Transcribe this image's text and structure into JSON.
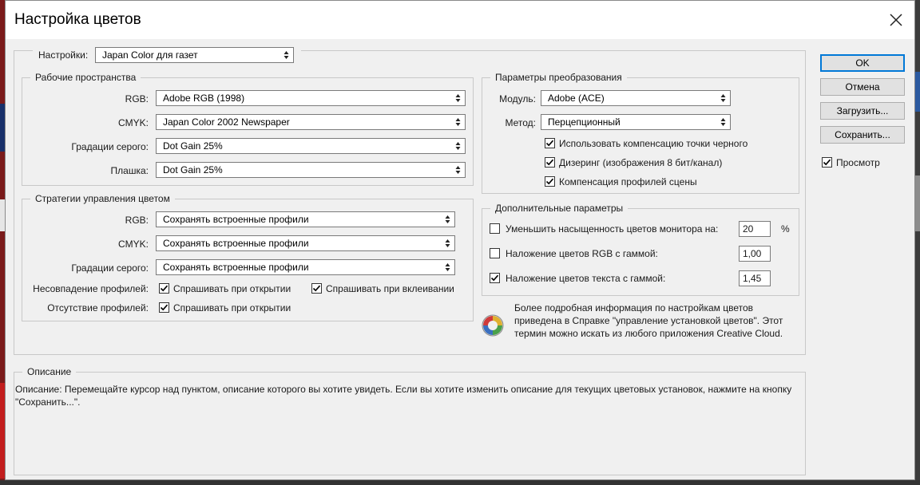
{
  "window": {
    "title": "Настройка цветов",
    "close_glyph": "close-icon"
  },
  "settings": {
    "label": "Настройки:",
    "value": "Japan Color для газет"
  },
  "working_spaces": {
    "legend": "Рабочие пространства",
    "rows": [
      {
        "label": "RGB:",
        "value": "Adobe RGB (1998)"
      },
      {
        "label": "CMYK:",
        "value": "Japan Color 2002 Newspaper"
      },
      {
        "label": "Градации серого:",
        "value": "Dot Gain 25%"
      },
      {
        "label": "Плашка:",
        "value": "Dot Gain 25%"
      }
    ]
  },
  "color_policies": {
    "legend": "Стратегии управления цветом",
    "rows": [
      {
        "label": "RGB:",
        "value": "Сохранять встроенные профили"
      },
      {
        "label": "CMYK:",
        "value": "Сохранять встроенные профили"
      },
      {
        "label": "Градации серого:",
        "value": "Сохранять встроенные профили"
      }
    ],
    "mismatch_label": "Несовпадение профилей:",
    "mismatch_open": {
      "label": "Спрашивать при открытии",
      "checked": true
    },
    "mismatch_paste": {
      "label": "Спрашивать при вклеивании",
      "checked": true
    },
    "missing_label": "Отсутствие профилей:",
    "missing_open": {
      "label": "Спрашивать при открытии",
      "checked": true
    }
  },
  "conversion": {
    "legend": "Параметры преобразования",
    "engine_label": "Модуль:",
    "engine_value": "Adobe (ACE)",
    "intent_label": "Метод:",
    "intent_value": "Перцепционный",
    "bpc": {
      "label": "Использовать компенсацию точки черного",
      "checked": true
    },
    "dither": {
      "label": "Дизеринг (изображения 8 бит/канал)",
      "checked": true
    },
    "scene": {
      "label": "Компенсация профилей сцены",
      "checked": true
    }
  },
  "advanced": {
    "legend": "Дополнительные параметры",
    "desaturate": {
      "label": "Уменьшить насыщенность цветов монитора на:",
      "checked": false,
      "value": "20",
      "unit": "%"
    },
    "blend_rgb": {
      "label": "Наложение цветов RGB с гаммой:",
      "checked": false,
      "value": "1,00"
    },
    "blend_text": {
      "label": "Наложение цветов текста с гаммой:",
      "checked": true,
      "value": "1,45"
    }
  },
  "info": {
    "icon": "color-wheel-icon",
    "text": "Более подробная информация по настройкам цветов приведена в Справке \"управление установкой цветов\". Этот термин можно искать из любого приложения Creative Cloud."
  },
  "description": {
    "legend": "Описание",
    "text": "Описание:  Перемещайте курсор над пунктом, описание которого вы хотите увидеть.  Если вы хотите изменить описание для текущих цветовых установок, нажмите на кнопку \"Сохранить...\"."
  },
  "buttons": {
    "ok": "OK",
    "cancel": "Отмена",
    "load": "Загрузить...",
    "save": "Сохранить...",
    "preview": {
      "label": "Просмотр",
      "checked": true
    }
  }
}
